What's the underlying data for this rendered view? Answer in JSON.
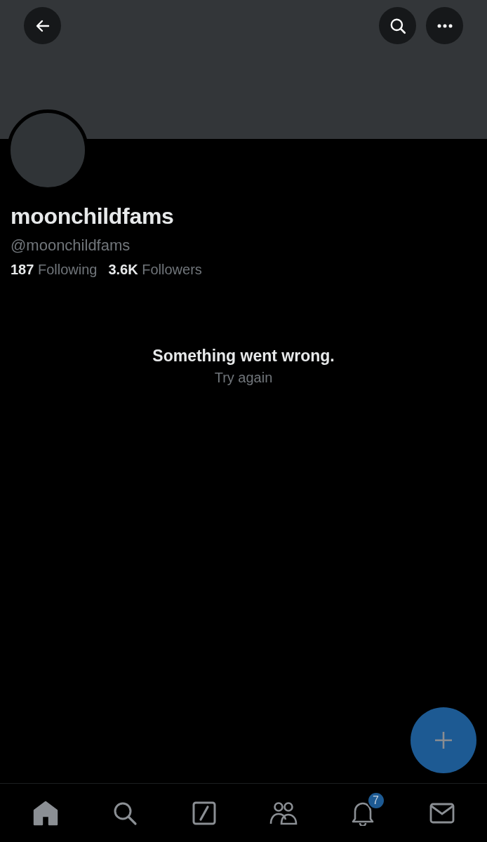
{
  "header": {
    "buttons": [
      {
        "kind": "back"
      },
      {
        "kind": "search"
      },
      {
        "kind": "more"
      }
    ]
  },
  "profile": {
    "name": "moonchildfams",
    "handle": "@moonchildfams",
    "stats": [
      {
        "count": "187",
        "label": "Following"
      },
      {
        "count": "3.6K",
        "label": "Followers"
      }
    ]
  },
  "error": {
    "title": "Something went wrong.",
    "action": "Try again"
  },
  "fab": {
    "kind": "compose"
  },
  "nav": {
    "items": [
      {
        "kind": "home",
        "selected": true
      },
      {
        "kind": "search",
        "selected": false
      },
      {
        "kind": "grok",
        "selected": false
      },
      {
        "kind": "communities",
        "selected": false
      },
      {
        "kind": "notifications",
        "selected": false,
        "badge": "7"
      },
      {
        "kind": "messages",
        "selected": false
      }
    ]
  }
}
